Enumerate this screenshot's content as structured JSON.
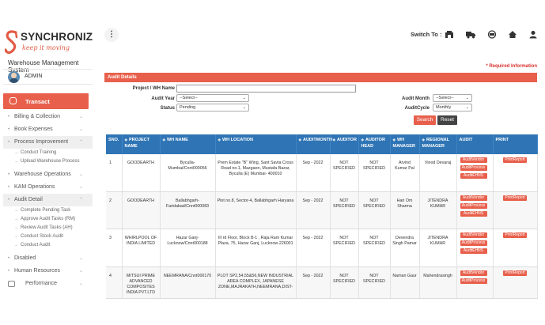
{
  "brand": {
    "name": "SYNCHRONIZED",
    "tagline": "keep it moving"
  },
  "app_title": "Warehouse Management System",
  "user": {
    "name": "ADMIN"
  },
  "sidebar": {
    "active_section": "Transact",
    "items": [
      {
        "label": "Billing & Collection"
      },
      {
        "label": "Book Expenses"
      },
      {
        "label": "Process Improvement",
        "sub": [
          "Conduct Training",
          "Upload Warehouse Process"
        ]
      },
      {
        "label": "Warehouse Operations"
      },
      {
        "label": "KAM Operations"
      },
      {
        "label": "Audit Detail",
        "sub": [
          "Complete Pending Task",
          "Approve Audit Tasks (RM)",
          "Review Audit Tasks (AH)",
          "Conduct Stock Audit",
          "Conduct Audit"
        ]
      },
      {
        "label": "Disabled"
      },
      {
        "label": "Human Resources"
      }
    ],
    "performance_label": "Performance"
  },
  "topbar": {
    "menu_glyph": "⋮",
    "switch_label": "Switch To :"
  },
  "form": {
    "required_note": "* Required Information",
    "panel_title": "Audit Details",
    "project_label": "Project / WH Name",
    "project_value": "",
    "audit_year_label": "Audit Year",
    "audit_year_value": "--Select--",
    "status_label": "Status",
    "status_value": "Pending",
    "audit_month_label": "Audit Month",
    "audit_month_value": "--Select--",
    "audit_cycle_label": "AuditCycle",
    "audit_cycle_value": "Monthly",
    "search_label": "Search",
    "reset_label": "Reset"
  },
  "table": {
    "headers": [
      "SNO.",
      "PROJECT NAME",
      "WH NAME",
      "WH LOCATION",
      "AUDITMONTH",
      "AUDITOR",
      "AUDITOR HEAD",
      "WH MANAGER",
      "REGIONAL MANAGER",
      "AUDIT",
      "PRINT"
    ],
    "rows": [
      {
        "sno": "1",
        "project": "GOODEARTH",
        "wh_name": "Byculla-Mumbai/Cnnt000056",
        "location": "Prem Estate \"B\" Wing, Sant Savta Cross Road no.1, Mazgaon, Mustafa Bazar, Byculla (E) Mumbai- 400010",
        "month": "Sep - 2022",
        "auditor": "NOT SPECIFIED",
        "auditor_head": "NOT SPECIFIED",
        "wh_manager": "Arvind Kumar Pal",
        "regional_manager": "Vinod Devaraj",
        "audit": [
          "AuditVendor",
          "AuditProcess",
          "AuditEHNS"
        ],
        "print": "PrintReport"
      },
      {
        "sno": "2",
        "project": "GOODEARTH",
        "wh_name": "Ballabhgarh-Faridabad/Cnnt000083",
        "location": "Plot no.8, Sector-4, Ballabhgarh Haryana",
        "month": "Sep - 2022",
        "auditor": "NOT SPECIFIED",
        "auditor_head": "NOT SPECIFIED",
        "wh_manager": "Hari Om Sharma",
        "regional_manager": "JITENDRA KUMAR",
        "audit": [
          "AuditVendor",
          "AuditProcess",
          "AuditEHNS"
        ],
        "print": "PrintReport"
      },
      {
        "sno": "3",
        "project": "WHIRLPOOL OF INDIA LIMITED",
        "wh_name": "Hazar Ganj-Lucknow/Cnnt000188",
        "location": "III rd Floor, Block B-1 , Raja Ram Kumar Plaza, 75, Hazar Ganj, Lucknow-226001",
        "month": "Sep - 2022",
        "auditor": "NOT SPECIFIED",
        "auditor_head": "NOT SPECIFIED",
        "wh_manager": "Devendra Singh Pamar",
        "regional_manager": "JITENDRA KUMAR",
        "audit": [
          "AuditVendor",
          "AuditProcess",
          "AuditEHNS"
        ],
        "print": "PrintReport"
      },
      {
        "sno": "4",
        "project": "MITSUI PRIME ADVANCED COMPOSITES INDIA PVT.LTD",
        "wh_name": "NEEMRANA/Cnnt000170",
        "location": "PLOT SP2,54,55&56,NEW INDUSTRIAL AREA COMPLEX, JAPANESE ZONE,MAJRAKATH,NEEMRANA,DIST-",
        "month": "Sep - 2022",
        "auditor": "NOT SPECIFIED",
        "auditor_head": "NOT SPECIFIED",
        "wh_manager": "Naman Gaur",
        "regional_manager": "Mahendrasingh",
        "audit": [
          "AuditVendor",
          "AuditProcess"
        ],
        "print": "PrintReport"
      }
    ]
  }
}
